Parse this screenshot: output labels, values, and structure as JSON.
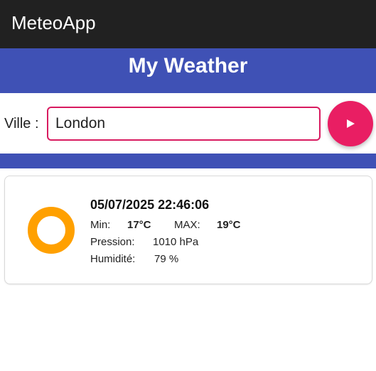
{
  "appbar": {
    "title": "MeteoApp"
  },
  "header": {
    "title": "My Weather"
  },
  "search": {
    "label": "Ville :",
    "value": "London",
    "button_icon": "play-icon"
  },
  "colors": {
    "appbar": "#212121",
    "primary": "#3f51b5",
    "accent": "#e91e63",
    "input_border": "#d81b60",
    "sun": "#ffa000"
  },
  "weather": {
    "datetime": "05/07/2025 22:46:06",
    "min_label": "Min:",
    "min_value": "17°C",
    "max_label": "MAX:",
    "max_value": "19°C",
    "pressure_label": "Pression:",
    "pressure_value": "1010 hPa",
    "humidity_label": "Humidité:",
    "humidity_value": "79 %",
    "icon": "sun-icon"
  }
}
